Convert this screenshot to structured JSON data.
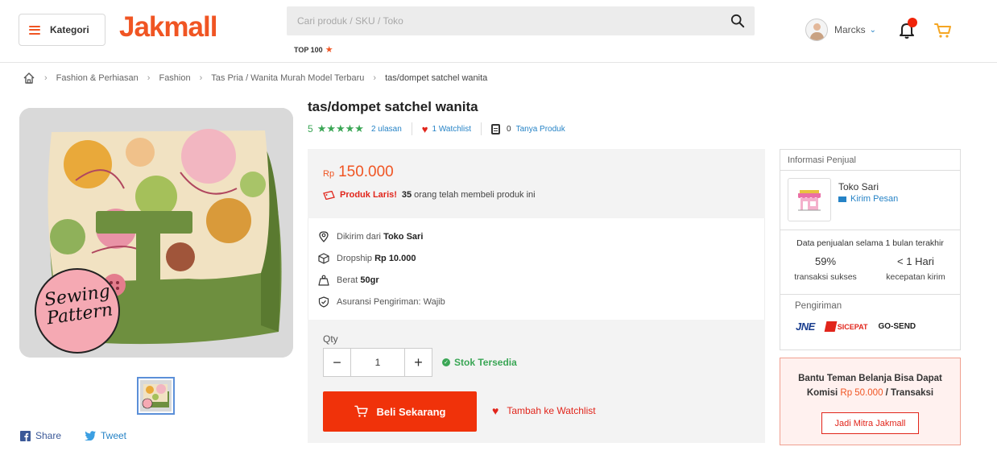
{
  "header": {
    "kategori_label": "Kategori",
    "logo": "Jakmall",
    "search_placeholder": "Cari produk / SKU / Toko",
    "top100": "TOP 100",
    "user_name": "Marcks",
    "icons": [
      "menu-icon",
      "search-icon",
      "star-icon",
      "avatar",
      "chevron-down-icon",
      "bell-icon",
      "cart-icon"
    ],
    "accent_color": "#f05523",
    "notification_dot_color": "#f0240a"
  },
  "breadcrumb": {
    "items": [
      "Fashion & Perhiasan",
      "Fashion",
      "Tas Pria / Wanita Murah Model Terbaru",
      "tas/dompet satchel wanita"
    ]
  },
  "product": {
    "title": "tas/dompet satchel wanita",
    "rating": "5",
    "stars": "★★★★★",
    "reviews": "2 ulasan",
    "watchlist": "1 Watchlist",
    "questions_count": "0",
    "questions_label": "Tanya Produk",
    "currency": "Rp",
    "price": "150.000",
    "laris_tag": "Produk Laris!",
    "laris_count": "35",
    "laris_text": "orang telah membeli produk ini",
    "image_label_line1": "Sewing",
    "image_label_line2": "Pattern"
  },
  "shipping_info": {
    "from_label": "Dikirim dari",
    "from_value": "Toko Sari",
    "dropship_label": "Dropship",
    "dropship_value": "Rp 10.000",
    "weight_label": "Berat",
    "weight_value": "50gr",
    "insurance": "Asuransi Pengiriman: Wajib"
  },
  "purchase": {
    "qty_label": "Qty",
    "qty_value": "1",
    "minus": "−",
    "plus": "+",
    "stock": "Stok Tersedia",
    "buy_label": "Beli Sekarang",
    "watchlist_label": "Tambah ke Watchlist",
    "buy_color": "#f0320a"
  },
  "social": {
    "share": "Share",
    "tweet": "Tweet"
  },
  "seller": {
    "header": "Informasi Penjual",
    "name": "Toko Sari",
    "message": "Kirim Pesan",
    "period_label": "Data penjualan selama 1 bulan terakhir",
    "success_value": "59%",
    "success_label": "transaksi sukses",
    "speed_value": "< 1 Hari",
    "speed_label": "kecepatan kirim",
    "shipping_label": "Pengiriman",
    "couriers": [
      "JNE",
      "SICEPAT",
      "GO-SEND"
    ]
  },
  "mitra": {
    "line1": "Bantu Teman Belanja Bisa Dapat",
    "line2_prefix": "Komisi",
    "amount": "Rp 50.000",
    "line2_suffix": "/ Transaksi",
    "button": "Jadi Mitra Jakmall"
  }
}
